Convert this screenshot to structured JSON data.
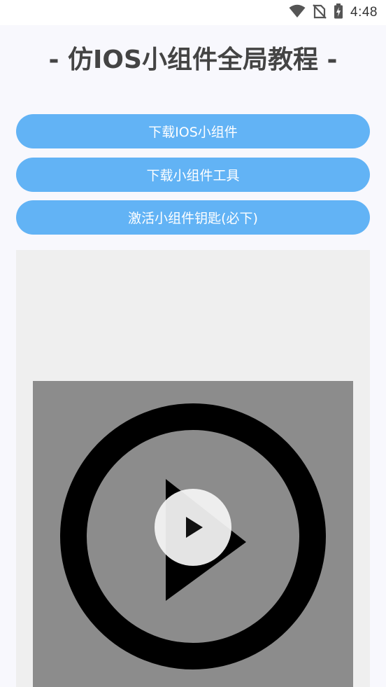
{
  "status_bar": {
    "time": "4:48",
    "icons": [
      "wifi-icon",
      "no-sim-icon",
      "battery-charging-icon"
    ]
  },
  "header": {
    "title": "- 仿IOS小组件全局教程 -"
  },
  "buttons": {
    "download_widget": "下载IOS小组件",
    "download_tool": "下载小组件工具",
    "activate_key": "激活小组件钥匙(必下)"
  },
  "video": {
    "thumbnail_icon": "play-circle-icon",
    "overlay_icon": "play-icon"
  },
  "colors": {
    "accent": "#62b3f5",
    "page_background": "#f8f8fd",
    "title_text": "#444444"
  }
}
